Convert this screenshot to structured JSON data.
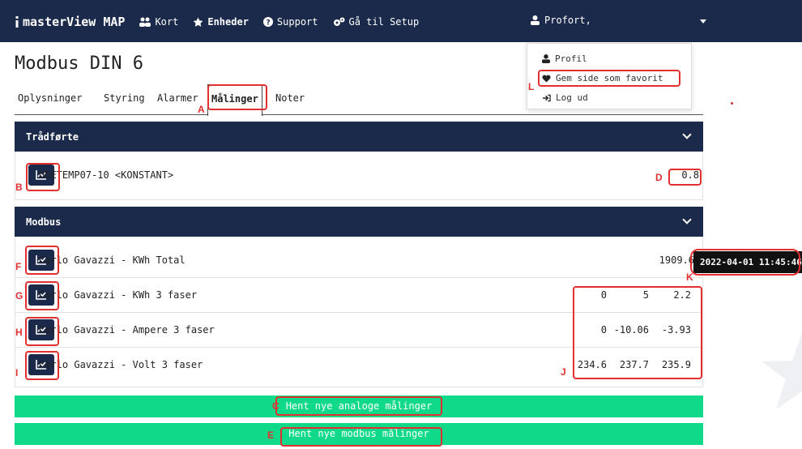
{
  "nav": {
    "brand": "masterView MAP",
    "links": [
      "Kort",
      "Enheder",
      "Support",
      "Gå til Setup"
    ],
    "user": "Profort,"
  },
  "page": {
    "title": "Modbus DIN 6"
  },
  "tabs": [
    {
      "label": "Oplysninger",
      "active": false
    },
    {
      "label": "Styring",
      "active": false
    },
    {
      "label": "Alarmer",
      "active": false
    },
    {
      "label": "Målinger",
      "active": true
    },
    {
      "label": "Noter",
      "active": false
    }
  ],
  "wired": {
    "title": "Trådførte",
    "rows": [
      {
        "label": "UDETEMP07-10 <KONSTANT>",
        "values": [
          "0.8"
        ]
      }
    ]
  },
  "modbus": {
    "title": "Modbus",
    "rows": [
      {
        "label": "Carlo Gavazzi - KWh Total",
        "values": [
          "1909.6"
        ]
      },
      {
        "label": "Carlo Gavazzi - KWh 3 faser",
        "values": [
          "0",
          "5",
          "2.2"
        ]
      },
      {
        "label": "Carlo Gavazzi - Ampere 3 faser",
        "values": [
          "0",
          "-10.06",
          "-3.93"
        ]
      },
      {
        "label": "Carlo Gavazzi - Volt 3 faser",
        "values": [
          "234.6",
          "237.7",
          "235.9"
        ]
      }
    ]
  },
  "actions": {
    "analog": "Hent nye analoge målinger",
    "modbus": "Hent nye modbus målinger"
  },
  "dropdown": {
    "profile": "Profil",
    "favorite": "Gem side som favorit",
    "logout": "Log ud"
  },
  "tooltip": "2022-04-01 11:45:46",
  "annotations": [
    "A",
    "B",
    "C",
    "D",
    "E",
    "F",
    "G",
    "H",
    "I",
    "J",
    "K",
    "L"
  ],
  "colors": {
    "navy": "#1b2a4a",
    "green": "#10d98a",
    "annotation": "#e03030"
  }
}
